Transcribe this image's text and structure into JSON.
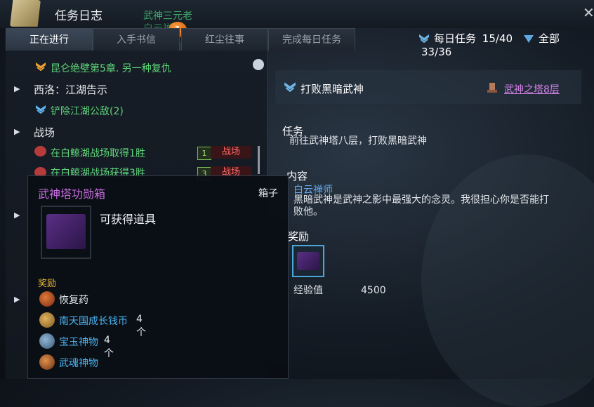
{
  "window": {
    "title": "任务日志",
    "close_icon": "close-icon"
  },
  "background_labels": {
    "npc_name": "武神三元老",
    "npc_name2": "白云禅师",
    "notification_count": "1"
  },
  "tabs": [
    {
      "label": "正在进行",
      "active": true
    },
    {
      "label": "入手书信",
      "active": false
    },
    {
      "label": "红尘往事",
      "active": false
    },
    {
      "label": "完成每日任务",
      "active": false
    }
  ],
  "counters": {
    "daily_label": "每日任务",
    "daily_value": "15/40",
    "all_label": "全部",
    "all_value": "33/36"
  },
  "quest_list": {
    "q1": "昆仑绝壁第5章. 另一种复仇",
    "cat_xiluo": "西洛：江湖告示",
    "q2": "铲除江湖公敌(2)",
    "cat_battle": "战场",
    "q3": "在白鲸湖战场取得1胜",
    "q3_count": "1",
    "q3_tag": "战场",
    "q4": "在白鲸湖战场获得3胜",
    "q4_count": "3",
    "q4_tag": "战场"
  },
  "detail": {
    "quest_title": "打败黑暗武神",
    "location_link": "武神之塔8层",
    "task_heading": "任务",
    "task_text": "前往武神塔八层，打败黑暗武神",
    "content_heading": "内容",
    "npc": "白云禅师",
    "content_text_1": "黑暗武神是武神之影中最强大的念灵。我很担心你是否能打",
    "content_text_2": "败他。",
    "reward_heading": "奖励",
    "exp_label": "经验值",
    "exp_value": "4500"
  },
  "tooltip": {
    "title": "武神塔功勋箱",
    "type": "箱子",
    "subtitle": "可获得道具",
    "reward_heading": "奖励",
    "rewards": [
      {
        "name": "恢复药",
        "count": "",
        "icon": "potion-icon",
        "name_color": "#e6e9ee"
      },
      {
        "name": "南天国成长钱币",
        "count": "4个",
        "icon": "coin-icon",
        "name_color": "#4db4f0"
      },
      {
        "name": "宝玉神物",
        "count": "4个",
        "icon": "jade-icon",
        "name_color": "#4db4f0"
      },
      {
        "name": "武魂神物",
        "count": "",
        "icon": "soul-icon",
        "name_color": "#4db4f0"
      }
    ]
  },
  "colors": {
    "accent_blue": "#4db4f0",
    "quest_green": "#5fd67a",
    "link_purple": "#d280e6",
    "tooltip_title": "#c86ee0",
    "battle_red": "#ff6a6a"
  }
}
